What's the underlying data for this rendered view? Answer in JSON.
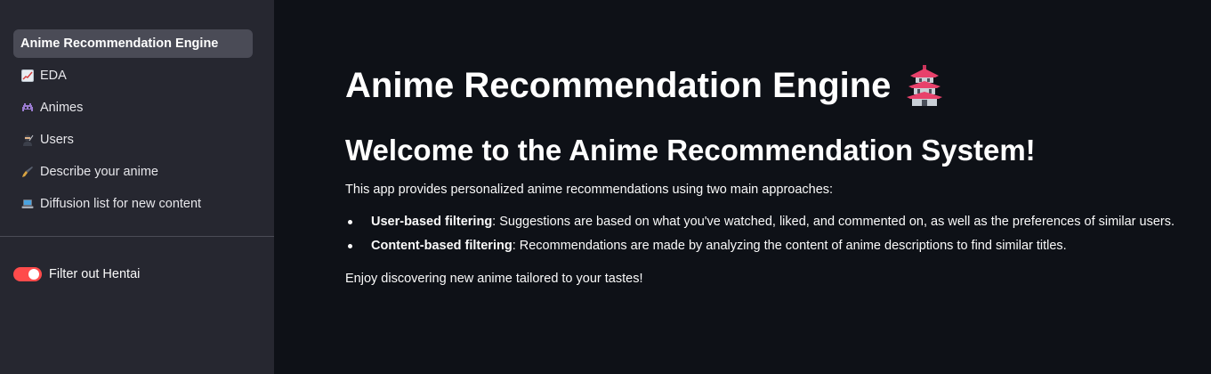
{
  "sidebar": {
    "nav": [
      {
        "label": "Anime Recommendation Engine",
        "icon": "none",
        "active": true
      },
      {
        "label": "EDA",
        "icon": "chart-increasing-icon"
      },
      {
        "label": "Animes",
        "icon": "space-invader-icon"
      },
      {
        "label": "Users",
        "icon": "ninja-icon"
      },
      {
        "label": "Describe your anime",
        "icon": "fountain-pen-icon"
      },
      {
        "label": "Diffusion list for new content",
        "icon": "laptop-icon"
      }
    ],
    "toggle": {
      "label": "Filter out Hentai",
      "on": true
    }
  },
  "main": {
    "title": "Anime Recommendation Engine",
    "title_icon": "pagoda-icon",
    "subtitle": "Welcome to the Anime Recommendation System!",
    "intro": "This app provides personalized anime recommendations using two main approaches:",
    "bullets": [
      {
        "term": "User-based filtering",
        "text": ": Suggestions are based on what you've watched, liked, and commented on, as well as the preferences of similar users."
      },
      {
        "term": "Content-based filtering",
        "text": ": Recommendations are made by analyzing the content of anime descriptions to find similar titles."
      }
    ],
    "outro": "Enjoy discovering new anime tailored to your tastes!"
  },
  "colors": {
    "sidebar_bg": "#262730",
    "main_bg": "#0e1117",
    "active_item_bg": "#4a4b56",
    "toggle_on": "#ff4b4b"
  }
}
